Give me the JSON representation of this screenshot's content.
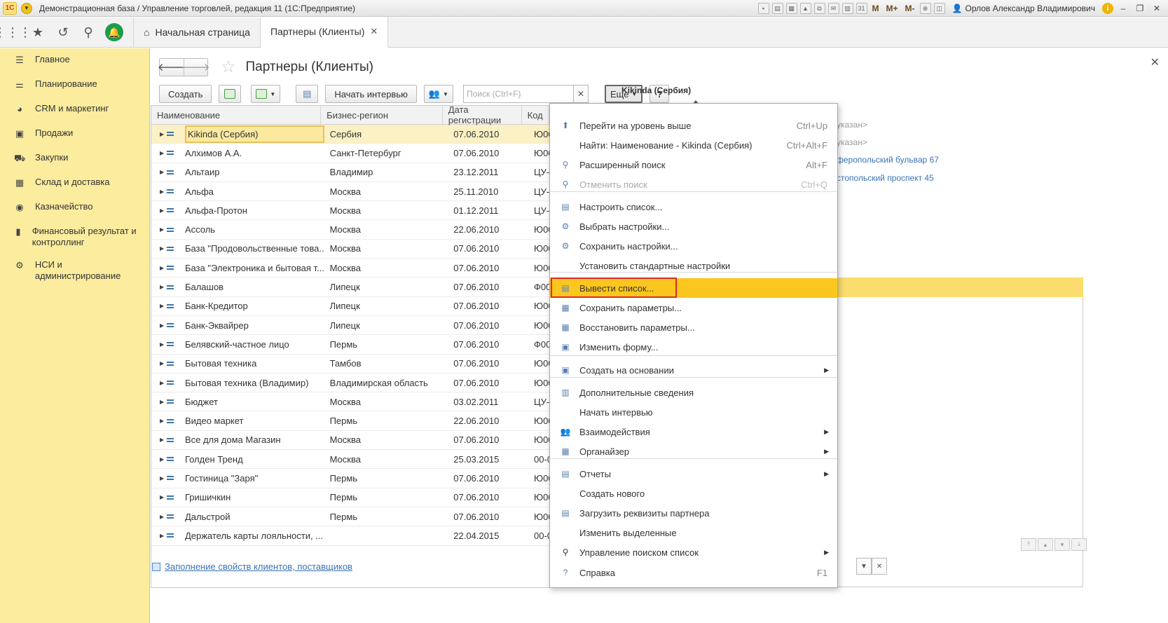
{
  "window": {
    "title": "Демонстрационная база / Управление торговлей, редакция 11  (1С:Предприятие)",
    "logo": "1С",
    "user": "Орлов Александр Владимирович",
    "m_buttons": [
      "M",
      "M+",
      "M-"
    ]
  },
  "topnav": {
    "tabs": [
      {
        "label": "Начальная страница"
      },
      {
        "label": "Партнеры (Клиенты)"
      }
    ]
  },
  "sidebar": {
    "items": [
      {
        "label": "Главное",
        "icon": "list-icon"
      },
      {
        "label": "Планирование",
        "icon": "planning-icon"
      },
      {
        "label": "CRM и маркетинг",
        "icon": "pie-icon"
      },
      {
        "label": "Продажи",
        "icon": "bag-icon"
      },
      {
        "label": "Закупки",
        "icon": "cart-icon"
      },
      {
        "label": "Склад и доставка",
        "icon": "warehouse-icon"
      },
      {
        "label": "Казначейство",
        "icon": "coin-icon"
      },
      {
        "label": "Финансовый результат и контроллинг",
        "icon": "barchart-icon"
      },
      {
        "label": "НСИ и администрирование",
        "icon": "gear-icon"
      }
    ]
  },
  "page": {
    "title": "Партнеры (Клиенты)",
    "toolbar": {
      "create": "Создать",
      "interview": "Начать интервью",
      "search_placeholder": "Поиск (Ctrl+F)",
      "more": "Еще",
      "help": "?"
    },
    "right_header": "Kikinda (Сербия)",
    "right_panel": {
      "line1": "указан>",
      "line2": "указан>",
      "link1": "феропольский бульвар 67",
      "link2": "стопольский проспект 45"
    },
    "bottom_link": "Заполнение свойств клиентов, поставщиков"
  },
  "table": {
    "columns": [
      "Наименование",
      "Бизнес-регион",
      "Дата регистрации",
      "Код"
    ],
    "rows": [
      {
        "name": "Kikinda (Сербия)",
        "region": "Сербия",
        "date": "07.06.2010",
        "code": "Ю00"
      },
      {
        "name": "Алхимов А.А.",
        "region": "Санкт-Петербург",
        "date": "07.06.2010",
        "code": "Ю00"
      },
      {
        "name": "Альтаир",
        "region": "Владимир",
        "date": "23.12.2011",
        "code": "ЦУ-0"
      },
      {
        "name": "Альфа",
        "region": "Москва",
        "date": "25.11.2010",
        "code": "ЦУ-0"
      },
      {
        "name": "Альфа-Протон",
        "region": "Москва",
        "date": "01.12.2011",
        "code": "ЦУ-0"
      },
      {
        "name": "Ассоль",
        "region": "Москва",
        "date": "22.06.2010",
        "code": "Ю00"
      },
      {
        "name": "База \"Продовольственные това...",
        "region": "Москва",
        "date": "07.06.2010",
        "code": "Ю00"
      },
      {
        "name": "База \"Электроника и бытовая т...",
        "region": "Москва",
        "date": "07.06.2010",
        "code": "Ю00"
      },
      {
        "name": "Балашов",
        "region": "Липецк",
        "date": "07.06.2010",
        "code": "Ф00"
      },
      {
        "name": "Банк-Кредитор",
        "region": "Липецк",
        "date": "07.06.2010",
        "code": "Ю00"
      },
      {
        "name": "Банк-Эквайрер",
        "region": "Липецк",
        "date": "07.06.2010",
        "code": "Ю00"
      },
      {
        "name": "Белявский-частное лицо",
        "region": "Пермь",
        "date": "07.06.2010",
        "code": "Ф00"
      },
      {
        "name": "Бытовая техника",
        "region": "Тамбов",
        "date": "07.06.2010",
        "code": "Ю00"
      },
      {
        "name": "Бытовая техника (Владимир)",
        "region": "Владимирская область",
        "date": "07.06.2010",
        "code": "Ю00"
      },
      {
        "name": "Бюджет",
        "region": "Москва",
        "date": "03.02.2011",
        "code": "ЦУ-0"
      },
      {
        "name": "Видео маркет",
        "region": "Пермь",
        "date": "22.06.2010",
        "code": "Ю00"
      },
      {
        "name": "Все для дома Магазин",
        "region": "Москва",
        "date": "07.06.2010",
        "code": "Ю00"
      },
      {
        "name": "Голден Тренд",
        "region": "Москва",
        "date": "25.03.2015",
        "code": "00-0"
      },
      {
        "name": "Гостиница \"Заря\"",
        "region": "Пермь",
        "date": "07.06.2010",
        "code": "Ю00"
      },
      {
        "name": "Гришичкин",
        "region": "Пермь",
        "date": "07.06.2010",
        "code": "Ю00"
      },
      {
        "name": "Дальстрой",
        "region": "Пермь",
        "date": "07.06.2010",
        "code": "Ю00"
      },
      {
        "name": "Держатель карты лояльности, ...",
        "region": "",
        "date": "22.04.2015",
        "code": "00-0"
      }
    ]
  },
  "menu": {
    "items": [
      {
        "label": "Перейти на уровень выше",
        "shortcut": "Ctrl+Up",
        "icon": "folder-up-icon"
      },
      {
        "label": "Найти: Наименование - Kikinda (Сербия)",
        "shortcut": "Ctrl+Alt+F",
        "icon": ""
      },
      {
        "label": "Расширенный поиск",
        "shortcut": "Alt+F",
        "icon": "search-icon"
      },
      {
        "label": "Отменить поиск",
        "shortcut": "Ctrl+Q",
        "icon": "cancel-search-icon"
      },
      {
        "label": "Настроить список...",
        "shortcut": "",
        "icon": "list-settings-icon"
      },
      {
        "label": "Выбрать настройки...",
        "shortcut": "",
        "icon": "choose-settings-icon"
      },
      {
        "label": "Сохранить настройки...",
        "shortcut": "",
        "icon": "save-settings-icon"
      },
      {
        "label": "Установить стандартные настройки",
        "shortcut": "",
        "icon": ""
      },
      {
        "label": "Вывести список...",
        "shortcut": "",
        "icon": "export-list-icon"
      },
      {
        "label": "Сохранить параметры...",
        "shortcut": "",
        "icon": "save-params-icon"
      },
      {
        "label": "Восстановить параметры...",
        "shortcut": "",
        "icon": "restore-params-icon"
      },
      {
        "label": "Изменить форму...",
        "shortcut": "",
        "icon": "form-icon"
      },
      {
        "label": "Создать на основании",
        "shortcut": "",
        "icon": "create-based-icon"
      },
      {
        "label": "Дополнительные сведения",
        "shortcut": "",
        "icon": "info-doc-icon"
      },
      {
        "label": "Начать интервью",
        "shortcut": "",
        "icon": ""
      },
      {
        "label": "Взаимодействия",
        "shortcut": "",
        "icon": "interactions-icon"
      },
      {
        "label": "Органайзер",
        "shortcut": "",
        "icon": "organizer-icon"
      },
      {
        "label": "Отчеты",
        "shortcut": "",
        "icon": "reports-icon"
      },
      {
        "label": "Создать нового",
        "shortcut": "",
        "icon": ""
      },
      {
        "label": "Загрузить реквизиты партнера",
        "shortcut": "",
        "icon": "load-details-icon"
      },
      {
        "label": "Изменить выделенные",
        "shortcut": "",
        "icon": ""
      },
      {
        "label": "Управление поиском список",
        "shortcut": "",
        "icon": "search-manage-icon"
      },
      {
        "label": "Справка",
        "shortcut": "F1",
        "icon": "help-icon"
      }
    ]
  }
}
